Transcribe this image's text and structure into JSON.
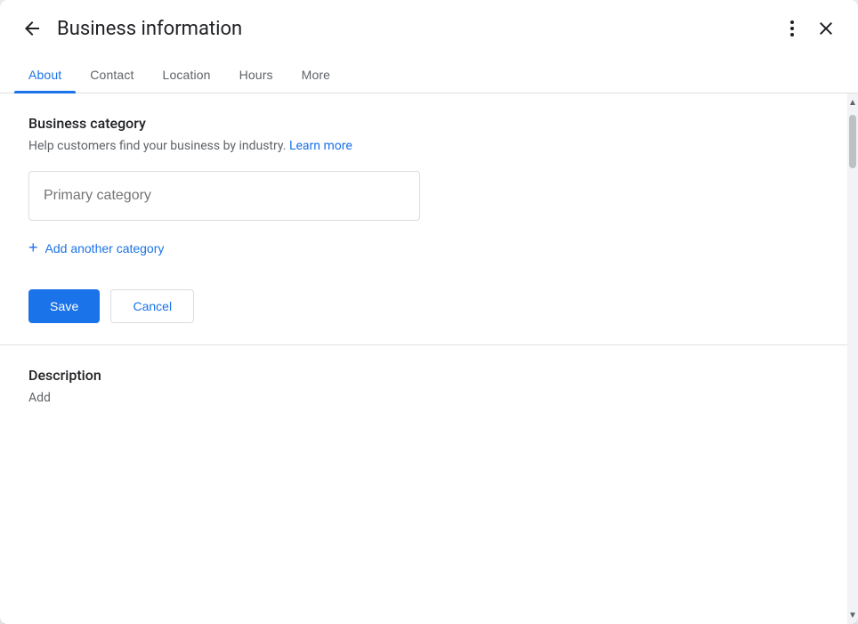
{
  "header": {
    "title": "Business information",
    "back_label": "back",
    "more_label": "more options",
    "close_label": "close"
  },
  "tabs": [
    {
      "id": "about",
      "label": "About",
      "active": true
    },
    {
      "id": "contact",
      "label": "Contact",
      "active": false
    },
    {
      "id": "location",
      "label": "Location",
      "active": false
    },
    {
      "id": "hours",
      "label": "Hours",
      "active": false
    },
    {
      "id": "more",
      "label": "More",
      "active": false
    }
  ],
  "business_category": {
    "title": "Business category",
    "description": "Help customers find your business by industry.",
    "learn_more": "Learn more",
    "primary_category_placeholder": "Primary category",
    "add_category_label": "Add another category"
  },
  "actions": {
    "save": "Save",
    "cancel": "Cancel"
  },
  "description": {
    "title": "Description",
    "add_label": "Add"
  }
}
